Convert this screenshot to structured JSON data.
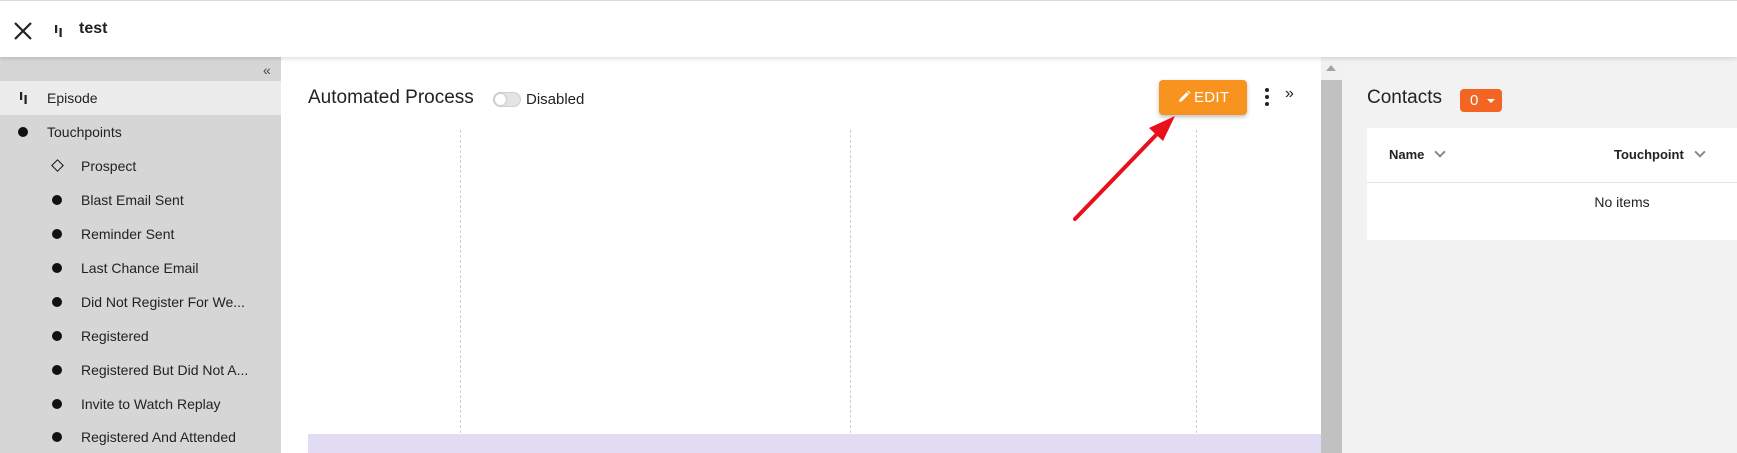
{
  "window": {
    "title": "test"
  },
  "sidebar": {
    "items": [
      {
        "label": "Episode",
        "marker": "episode-icon",
        "active": true
      },
      {
        "label": "Touchpoints",
        "marker": "bullet-icon"
      },
      {
        "label": "Prospect",
        "marker": "diamond-icon"
      },
      {
        "label": "Blast Email Sent",
        "marker": "bullet-icon"
      },
      {
        "label": "Reminder Sent",
        "marker": "bullet-icon"
      },
      {
        "label": "Last Chance Email",
        "marker": "bullet-icon"
      },
      {
        "label": "Did Not Register For We...",
        "marker": "bullet-icon"
      },
      {
        "label": "Registered",
        "marker": "bullet-icon"
      },
      {
        "label": "Registered But Did Not A...",
        "marker": "bullet-icon"
      },
      {
        "label": "Invite to Watch Replay",
        "marker": "bullet-icon"
      },
      {
        "label": "Registered And Attended",
        "marker": "bullet-icon"
      }
    ]
  },
  "main": {
    "title": "Automated Process",
    "toggle_label": "Disabled",
    "toggle_on": false,
    "edit_label": "EDIT"
  },
  "contacts": {
    "title": "Contacts",
    "count": "0",
    "columns": [
      "Name",
      "Touchpoint"
    ],
    "empty_text": "No items"
  },
  "colors": {
    "edit_button": "#f7931e",
    "count_badge": "#f26522",
    "sidebar_bg": "#d6d6d6",
    "lane_bg": "#e3dcf5",
    "annotation_arrow": "#e8101b"
  }
}
